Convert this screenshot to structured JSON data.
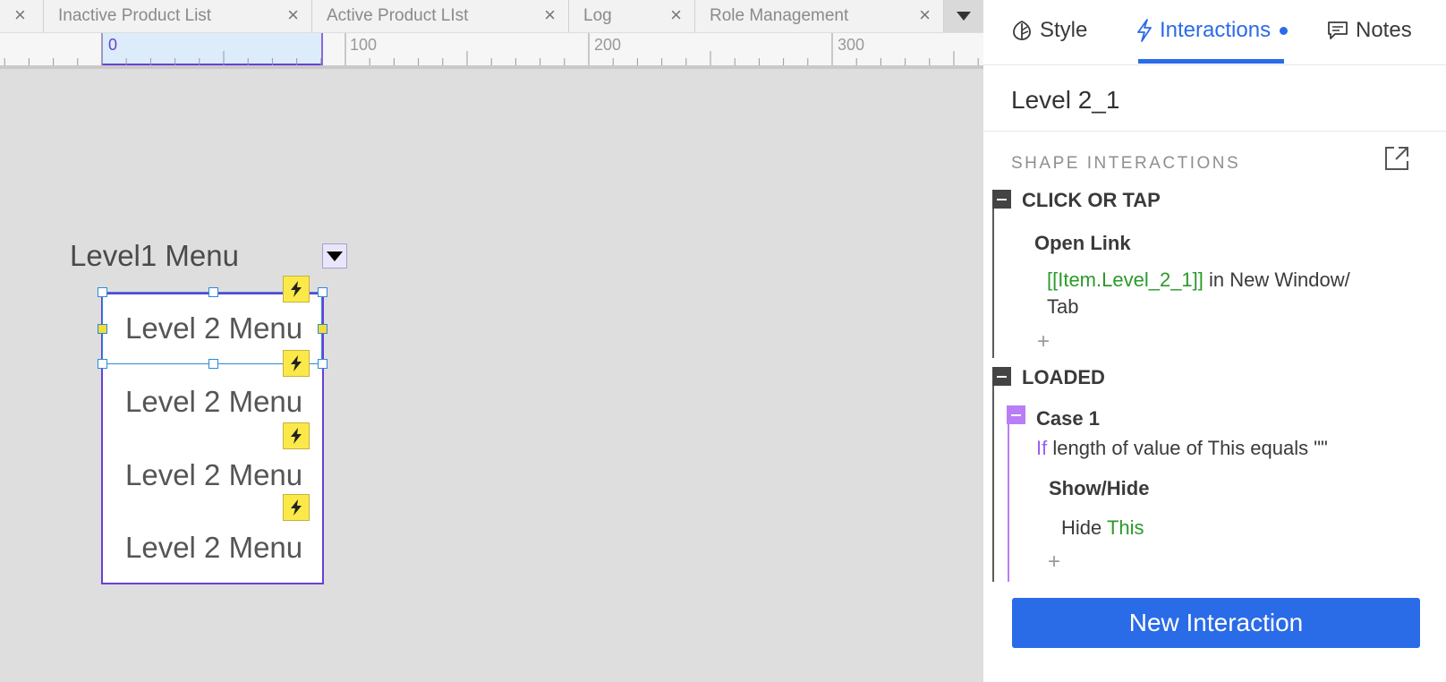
{
  "tabs": [
    {
      "label": ""
    },
    {
      "label": "Inactive Product List"
    },
    {
      "label": "Active Product LIst"
    },
    {
      "label": "Log"
    },
    {
      "label": "Role Management"
    }
  ],
  "ruler": {
    "labels": [
      "0",
      "100",
      "200",
      "300"
    ]
  },
  "canvas": {
    "level1_label": "Level1 Menu",
    "level2_items": [
      "Level 2 Menu",
      "Level 2 Menu",
      "Level 2 Menu",
      "Level 2 Menu"
    ]
  },
  "panel": {
    "tabs": {
      "style": "Style",
      "interactions": "Interactions",
      "notes": "Notes"
    },
    "widget_name": "Level 2_1",
    "section_title": "SHAPE INTERACTIONS",
    "click_event": {
      "title": "CLICK OR TAP",
      "action_title": "Open Link",
      "target": "[[Item.Level_2_1]]",
      "detail_line1": " in New Window/",
      "detail_line2": "Tab"
    },
    "loaded_event": {
      "title": "LOADED",
      "case_title": "Case 1",
      "condition_keyword": "If",
      "condition_text": " length of value of This equals \"\"",
      "action_title": "Show/Hide",
      "action_verb": "Hide ",
      "action_target": "This"
    },
    "plus_symbol": "+",
    "new_interaction_label": "New Interaction"
  },
  "colors": {
    "accent": "#2a6be8",
    "selection": "#2a8ad6",
    "widget_border": "#6a3fd6",
    "case": "#b97ef5",
    "green_text": "#2a9a2a"
  }
}
